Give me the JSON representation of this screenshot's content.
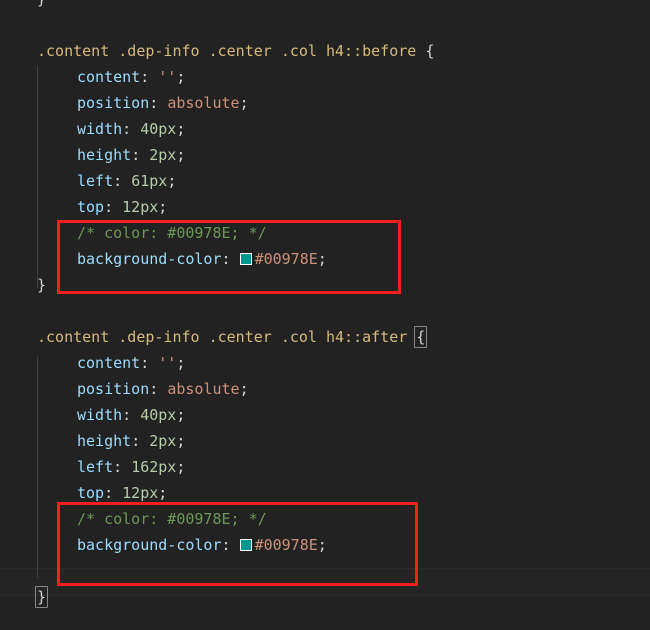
{
  "editor": {
    "language": "css",
    "theme": "dark",
    "background_color": "#222222",
    "default_text_color": "#d4d4d4",
    "indent_guide_color": "#404040",
    "colors": {
      "selector": "#d7ba7d",
      "property": "#9cdcfe",
      "value_keyword": "#ce9178",
      "number": "#b5cea8",
      "comment": "#6a9955",
      "punctuation": "#d4d4d4",
      "annotation_box": "#f3201f",
      "swatch_border": "#ffffff"
    }
  },
  "code": {
    "lines": [
      {
        "id": "line-1",
        "indent": 0,
        "tokens": [
          {
            "kind": "punct",
            "text": "}"
          }
        ]
      },
      {
        "id": "line-2",
        "indent": 0,
        "tokens": []
      },
      {
        "id": "line-3",
        "indent": 0,
        "tokens": [
          {
            "kind": "selector",
            "text": ".content .dep-info .center .col h4::before"
          },
          {
            "kind": "punct",
            "text": " {"
          }
        ]
      },
      {
        "id": "line-4",
        "indent": 1,
        "tokens": [
          {
            "kind": "prop",
            "text": "content"
          },
          {
            "kind": "punct",
            "text": ": "
          },
          {
            "kind": "value",
            "text": "''"
          },
          {
            "kind": "punct",
            "text": ";"
          }
        ]
      },
      {
        "id": "line-5",
        "indent": 1,
        "tokens": [
          {
            "kind": "prop",
            "text": "position"
          },
          {
            "kind": "punct",
            "text": ": "
          },
          {
            "kind": "keyword",
            "text": "absolute"
          },
          {
            "kind": "punct",
            "text": ";"
          }
        ]
      },
      {
        "id": "line-6",
        "indent": 1,
        "tokens": [
          {
            "kind": "prop",
            "text": "width"
          },
          {
            "kind": "punct",
            "text": ": "
          },
          {
            "kind": "num",
            "text": "40px"
          },
          {
            "kind": "punct",
            "text": ";"
          }
        ]
      },
      {
        "id": "line-7",
        "indent": 1,
        "tokens": [
          {
            "kind": "prop",
            "text": "height"
          },
          {
            "kind": "punct",
            "text": ": "
          },
          {
            "kind": "num",
            "text": "2px"
          },
          {
            "kind": "punct",
            "text": ";"
          }
        ]
      },
      {
        "id": "line-8",
        "indent": 1,
        "tokens": [
          {
            "kind": "prop",
            "text": "left"
          },
          {
            "kind": "punct",
            "text": ": "
          },
          {
            "kind": "num",
            "text": "61px"
          },
          {
            "kind": "punct",
            "text": ";"
          }
        ]
      },
      {
        "id": "line-9",
        "indent": 1,
        "tokens": [
          {
            "kind": "prop",
            "text": "top"
          },
          {
            "kind": "punct",
            "text": ": "
          },
          {
            "kind": "num",
            "text": "12px"
          },
          {
            "kind": "punct",
            "text": ";"
          }
        ]
      },
      {
        "id": "line-10",
        "indent": 1,
        "tokens": [
          {
            "kind": "comment",
            "text": "/* color: #00978E; */"
          }
        ]
      },
      {
        "id": "line-11",
        "indent": 1,
        "swatch": "#00978E",
        "tokens": [
          {
            "kind": "prop",
            "text": "background-color"
          },
          {
            "kind": "punct",
            "text": ": "
          },
          {
            "kind": "swatch",
            "text": ""
          },
          {
            "kind": "hex",
            "text": "#00978E"
          },
          {
            "kind": "punct",
            "text": ";"
          }
        ]
      },
      {
        "id": "line-12",
        "indent": 0,
        "tokens": [
          {
            "kind": "punct",
            "text": "}"
          }
        ]
      },
      {
        "id": "line-13",
        "indent": 0,
        "tokens": []
      },
      {
        "id": "line-14",
        "indent": 0,
        "tokens": [
          {
            "kind": "selector",
            "text": ".content .dep-info .center .col h4::after"
          },
          {
            "kind": "punct",
            "text": " "
          },
          {
            "kind": "bracket-match",
            "text": "{"
          }
        ]
      },
      {
        "id": "line-15",
        "indent": 1,
        "tokens": [
          {
            "kind": "prop",
            "text": "content"
          },
          {
            "kind": "punct",
            "text": ": "
          },
          {
            "kind": "value",
            "text": "''"
          },
          {
            "kind": "punct",
            "text": ";"
          }
        ]
      },
      {
        "id": "line-16",
        "indent": 1,
        "tokens": [
          {
            "kind": "prop",
            "text": "position"
          },
          {
            "kind": "punct",
            "text": ": "
          },
          {
            "kind": "keyword",
            "text": "absolute"
          },
          {
            "kind": "punct",
            "text": ";"
          }
        ]
      },
      {
        "id": "line-17",
        "indent": 1,
        "tokens": [
          {
            "kind": "prop",
            "text": "width"
          },
          {
            "kind": "punct",
            "text": ": "
          },
          {
            "kind": "num",
            "text": "40px"
          },
          {
            "kind": "punct",
            "text": ";"
          }
        ]
      },
      {
        "id": "line-18",
        "indent": 1,
        "tokens": [
          {
            "kind": "prop",
            "text": "height"
          },
          {
            "kind": "punct",
            "text": ": "
          },
          {
            "kind": "num",
            "text": "2px"
          },
          {
            "kind": "punct",
            "text": ";"
          }
        ]
      },
      {
        "id": "line-19",
        "indent": 1,
        "tokens": [
          {
            "kind": "prop",
            "text": "left"
          },
          {
            "kind": "punct",
            "text": ": "
          },
          {
            "kind": "num",
            "text": "162px"
          },
          {
            "kind": "punct",
            "text": ";"
          }
        ]
      },
      {
        "id": "line-20",
        "indent": 1,
        "tokens": [
          {
            "kind": "prop",
            "text": "top"
          },
          {
            "kind": "punct",
            "text": ": "
          },
          {
            "kind": "num",
            "text": "12px"
          },
          {
            "kind": "punct",
            "text": ";"
          }
        ]
      },
      {
        "id": "line-21",
        "indent": 1,
        "tokens": [
          {
            "kind": "comment",
            "text": "/* color: #00978E; */"
          }
        ]
      },
      {
        "id": "line-22",
        "indent": 1,
        "swatch": "#00978E",
        "tokens": [
          {
            "kind": "prop",
            "text": "background-color"
          },
          {
            "kind": "punct",
            "text": ": "
          },
          {
            "kind": "swatch",
            "text": ""
          },
          {
            "kind": "hex",
            "text": "#00978E"
          },
          {
            "kind": "punct",
            "text": ";"
          }
        ]
      },
      {
        "id": "line-23",
        "indent": 0,
        "tokens": []
      },
      {
        "id": "line-24",
        "indent": 0,
        "tokens": [
          {
            "kind": "bracket-match",
            "text": "}"
          }
        ]
      }
    ]
  },
  "annotations": [
    {
      "id": "highlight-box-1",
      "label": "background-color declaration highlight 1",
      "color": "#f3201f"
    },
    {
      "id": "highlight-box-2",
      "label": "background-color declaration highlight 2",
      "color": "#f3201f"
    }
  ]
}
